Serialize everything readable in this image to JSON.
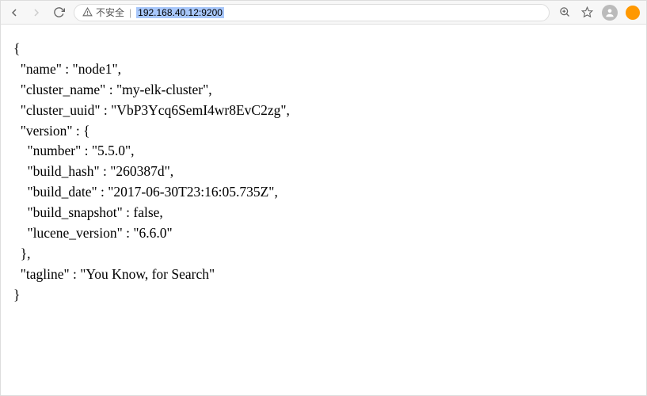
{
  "toolbar": {
    "security_label": "不安全",
    "url": "192.168.40.12:9200"
  },
  "response": {
    "name": "node1",
    "cluster_name": "my-elk-cluster",
    "cluster_uuid": "VbP3Ycq6SemI4wr8EvC2zg",
    "version": {
      "number": "5.5.0",
      "build_hash": "260387d",
      "build_date": "2017-06-30T23:16:05.735Z",
      "build_snapshot": false,
      "lucene_version": "6.6.0"
    },
    "tagline": "You Know, for Search"
  }
}
